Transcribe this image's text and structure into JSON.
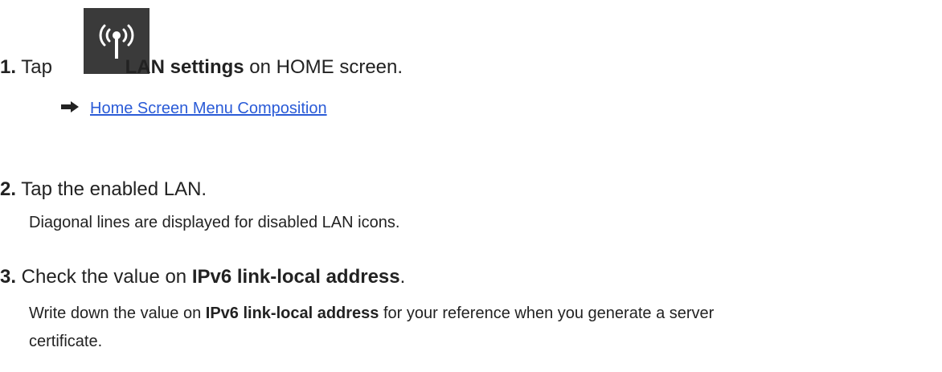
{
  "steps": [
    {
      "number": "1.",
      "pre": " Tap ",
      "bold": "LAN settings",
      "post": " on HOME screen.",
      "icon": "wireless-antenna-icon",
      "link": {
        "arrow_icon": "right-arrow-icon",
        "text": "Home Screen Menu Composition"
      }
    },
    {
      "number": "2.",
      "text": " Tap the enabled LAN.",
      "description": "Diagonal lines are displayed for disabled LAN icons."
    },
    {
      "number": "3.",
      "pre": " Check the value on ",
      "bold": "IPv6 link-local address",
      "post": ".",
      "description": {
        "pre": "Write down the value on ",
        "bold": "IPv6 link-local address",
        "post_line1": " for your reference when you generate a server",
        "line2": "certificate."
      }
    }
  ],
  "colors": {
    "text": "#222222",
    "link": "#2a5bd7",
    "icon_bg": "#3a3a3a",
    "icon_fg": "#ffffff"
  }
}
